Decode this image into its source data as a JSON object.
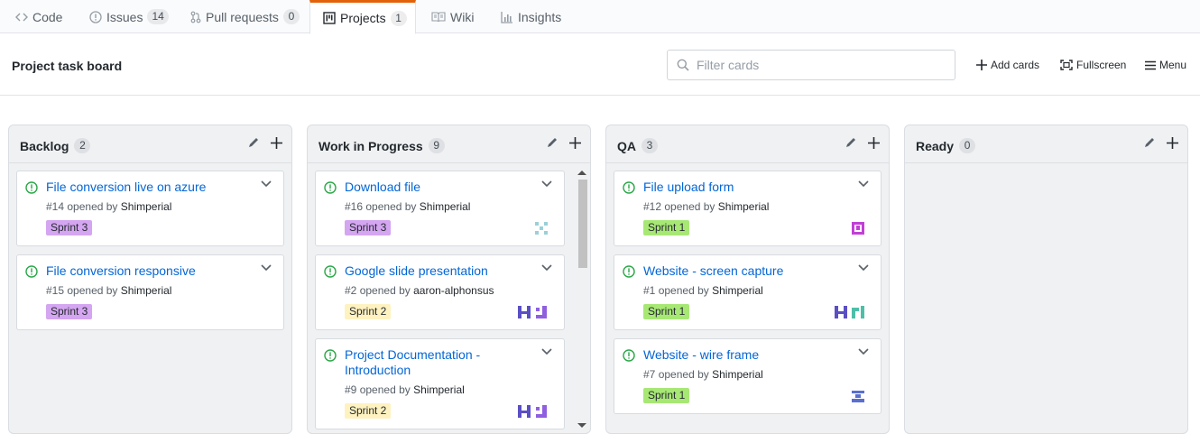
{
  "nav": {
    "code": "Code",
    "issues": "Issues",
    "issues_count": "14",
    "pulls": "Pull requests",
    "pulls_count": "0",
    "projects": "Projects",
    "projects_count": "1",
    "wiki": "Wiki",
    "insights": "Insights"
  },
  "header": {
    "title": "Project task board",
    "filter_placeholder": "Filter cards",
    "add_cards": "Add cards",
    "fullscreen": "Fullscreen",
    "menu": "Menu"
  },
  "colors": {
    "link": "#0366d6",
    "open_issue": "#28a745",
    "sprint3": "#d4a5f0",
    "sprint2": "#fef2c0",
    "sprint1": "#a7e875",
    "selected_tab_accent": "#e36209"
  },
  "columns": [
    {
      "name": "Backlog",
      "count": "2",
      "cards": [
        {
          "title": "File conversion live on azure",
          "number": "#14",
          "opened_by": "opened by",
          "author": "Shimperial",
          "label": "Sprint 3"
        },
        {
          "title": "File conversion responsive",
          "number": "#15",
          "opened_by": "opened by",
          "author": "Shimperial",
          "label": "Sprint 3"
        }
      ]
    },
    {
      "name": "Work in Progress",
      "count": "9",
      "cards": [
        {
          "title": "Download file",
          "number": "#16",
          "opened_by": "opened by",
          "author": "Shimperial",
          "label": "Sprint 3"
        },
        {
          "title": "Google slide presentation",
          "number": "#2",
          "opened_by": "opened by",
          "author": "aaron-alphonsus",
          "label": "Sprint 2"
        },
        {
          "title": "Project Documentation - Introduction",
          "number": "#9",
          "opened_by": "opened by",
          "author": "Shimperial",
          "label": "Sprint 2"
        }
      ]
    },
    {
      "name": "QA",
      "count": "3",
      "cards": [
        {
          "title": "File upload form",
          "number": "#12",
          "opened_by": "opened by",
          "author": "Shimperial",
          "label": "Sprint 1"
        },
        {
          "title": "Website - screen capture",
          "number": "#1",
          "opened_by": "opened by",
          "author": "Shimperial",
          "label": "Sprint 1"
        },
        {
          "title": "Website - wire frame",
          "number": "#7",
          "opened_by": "opened by",
          "author": "Shimperial",
          "label": "Sprint 1"
        }
      ]
    },
    {
      "name": "Ready",
      "count": "0",
      "cards": []
    }
  ]
}
